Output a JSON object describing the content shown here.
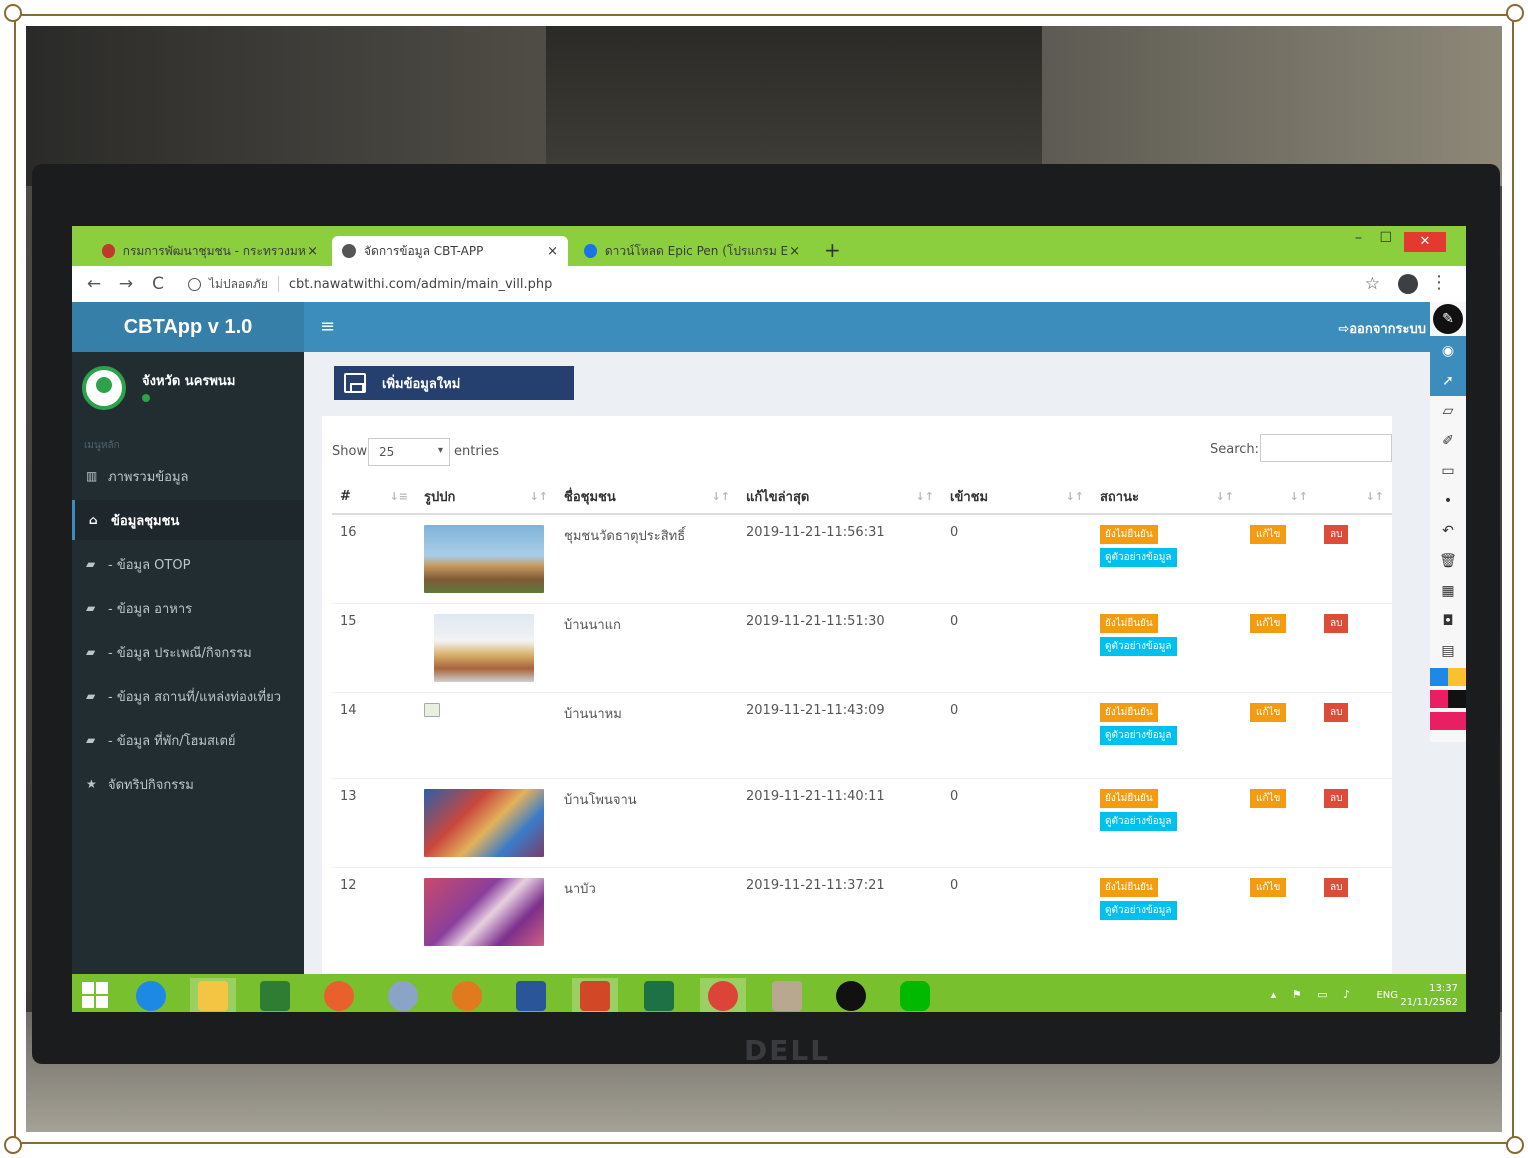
{
  "browser": {
    "tabs": [
      {
        "label": "กรมการพัฒนาชุมชน - กระทรวงมหาดไ",
        "close": "×",
        "favicon_color": "#c0392b"
      },
      {
        "label": "จัดการข้อมูล CBT-APP",
        "close": "×",
        "favicon_color": "#555555"
      },
      {
        "label": "ดาวน์โหลด Epic Pen (โปรแกรม Epic",
        "close": "×",
        "favicon_color": "#1a73e8"
      }
    ],
    "new_tab": "+",
    "window_controls": {
      "minimize": "–",
      "maximize": "☐",
      "close": "✕"
    },
    "nav": {
      "back": "←",
      "forward": "→",
      "reload": "C"
    },
    "security_label": "ไม่ปลอดภัย",
    "url": "cbt.nawatwithi.com/admin/main_vill.php",
    "star": "☆",
    "menu": "⋮"
  },
  "app": {
    "logo": "CBTApp v 1.0",
    "toggle": "≡",
    "logout": "ออกจากระบบ"
  },
  "sidebar": {
    "user_name": "จังหวัด นครพนม",
    "header": "เมนูหลัก",
    "items": [
      {
        "label": "ภาพรวมข้อมูล",
        "icon": "bar-chart-icon",
        "glyph": "▥"
      },
      {
        "label": "ข้อมูลชุมชน",
        "icon": "home-icon",
        "glyph": "⌂"
      },
      {
        "label": "- ข้อมูล OTOP",
        "icon": "book-icon",
        "glyph": "▰"
      },
      {
        "label": "- ข้อมูล อาหาร",
        "icon": "book-icon",
        "glyph": "▰"
      },
      {
        "label": "- ข้อมูล ประเพณี/กิจกรรม",
        "icon": "book-icon",
        "glyph": "▰"
      },
      {
        "label": "- ข้อมูล สถานที่/แหล่งท่องเที่ยว",
        "icon": "book-icon",
        "glyph": "▰"
      },
      {
        "label": "- ข้อมูล ที่พัก/โฮมสเตย์",
        "icon": "book-icon",
        "glyph": "▰"
      },
      {
        "label": "จัดทริปกิจกรรม",
        "icon": "star-icon",
        "glyph": "★"
      }
    ]
  },
  "content": {
    "add_button": "เพิ่มข้อมูลใหม่",
    "show_label": "Show",
    "page_length": "25",
    "entries_label": "entries",
    "search_label": "Search:",
    "columns": [
      "#",
      "รูปปก",
      "ชื่อชุมชน",
      "แก้ไขล่าสุด",
      "เข้าชม",
      "สถานะ",
      "",
      ""
    ],
    "rows": [
      {
        "id": "16",
        "name": "ชุมชนวัดธาตุประสิทธิ์",
        "updated": "2019-11-21-11:56:31",
        "views": "0",
        "status": "ยังไม่ยืนยัน",
        "preview": "ดูตัวอย่างข้อมูล",
        "edit": "แก้ไข",
        "delete": "ลบ",
        "thumb": "temple-sky"
      },
      {
        "id": "15",
        "name": "บ้านนาแก",
        "updated": "2019-11-21-11:51:30",
        "views": "0",
        "status": "ยังไม่ยืนยัน",
        "preview": "ดูตัวอย่างข้อมูล",
        "edit": "แก้ไข",
        "delete": "ลบ",
        "thumb": "temple-white"
      },
      {
        "id": "14",
        "name": "บ้านนาหม",
        "updated": "2019-11-21-11:43:09",
        "views": "0",
        "status": "ยังไม่ยืนยัน",
        "preview": "ดูตัวอย่างข้อมูล",
        "edit": "แก้ไข",
        "delete": "ลบ",
        "thumb": "broken"
      },
      {
        "id": "13",
        "name": "บ้านโพนจาน",
        "updated": "2019-11-21-11:40:11",
        "views": "0",
        "status": "ยังไม่ยืนยัน",
        "preview": "ดูตัวอย่างข้อมูล",
        "edit": "แก้ไข",
        "delete": "ลบ",
        "thumb": "collage-blue"
      },
      {
        "id": "12",
        "name": "นาบัว",
        "updated": "2019-11-21-11:37:21",
        "views": "0",
        "status": "ยังไม่ยืนยัน",
        "preview": "ดูตัวอย่างข้อมูล",
        "edit": "แก้ไข",
        "delete": "ลบ",
        "thumb": "collage-purple"
      }
    ]
  },
  "taskbar": {
    "language": "ENG",
    "time": "13:37",
    "date": "21/11/2562",
    "apps": [
      {
        "name": "ie-icon",
        "color": "#1e88e5"
      },
      {
        "name": "file-explorer-icon",
        "color": "#f4c542"
      },
      {
        "name": "store-icon",
        "color": "#2e7d32"
      },
      {
        "name": "firefox-icon",
        "color": "#e8612c"
      },
      {
        "name": "paint-icon",
        "color": "#8aa4c8"
      },
      {
        "name": "sync-icon",
        "color": "#e07a1f"
      },
      {
        "name": "word-icon",
        "color": "#2a5699"
      },
      {
        "name": "powerpoint-icon",
        "color": "#d24726"
      },
      {
        "name": "excel-icon",
        "color": "#1e7145"
      },
      {
        "name": "chrome-icon",
        "color": "#db4437"
      },
      {
        "name": "window-icon",
        "color": "#b8a890"
      },
      {
        "name": "epic-pen-icon",
        "color": "#111111"
      },
      {
        "name": "line-icon",
        "color": "#00b900"
      }
    ]
  },
  "monitor": {
    "brand": "DELL"
  }
}
